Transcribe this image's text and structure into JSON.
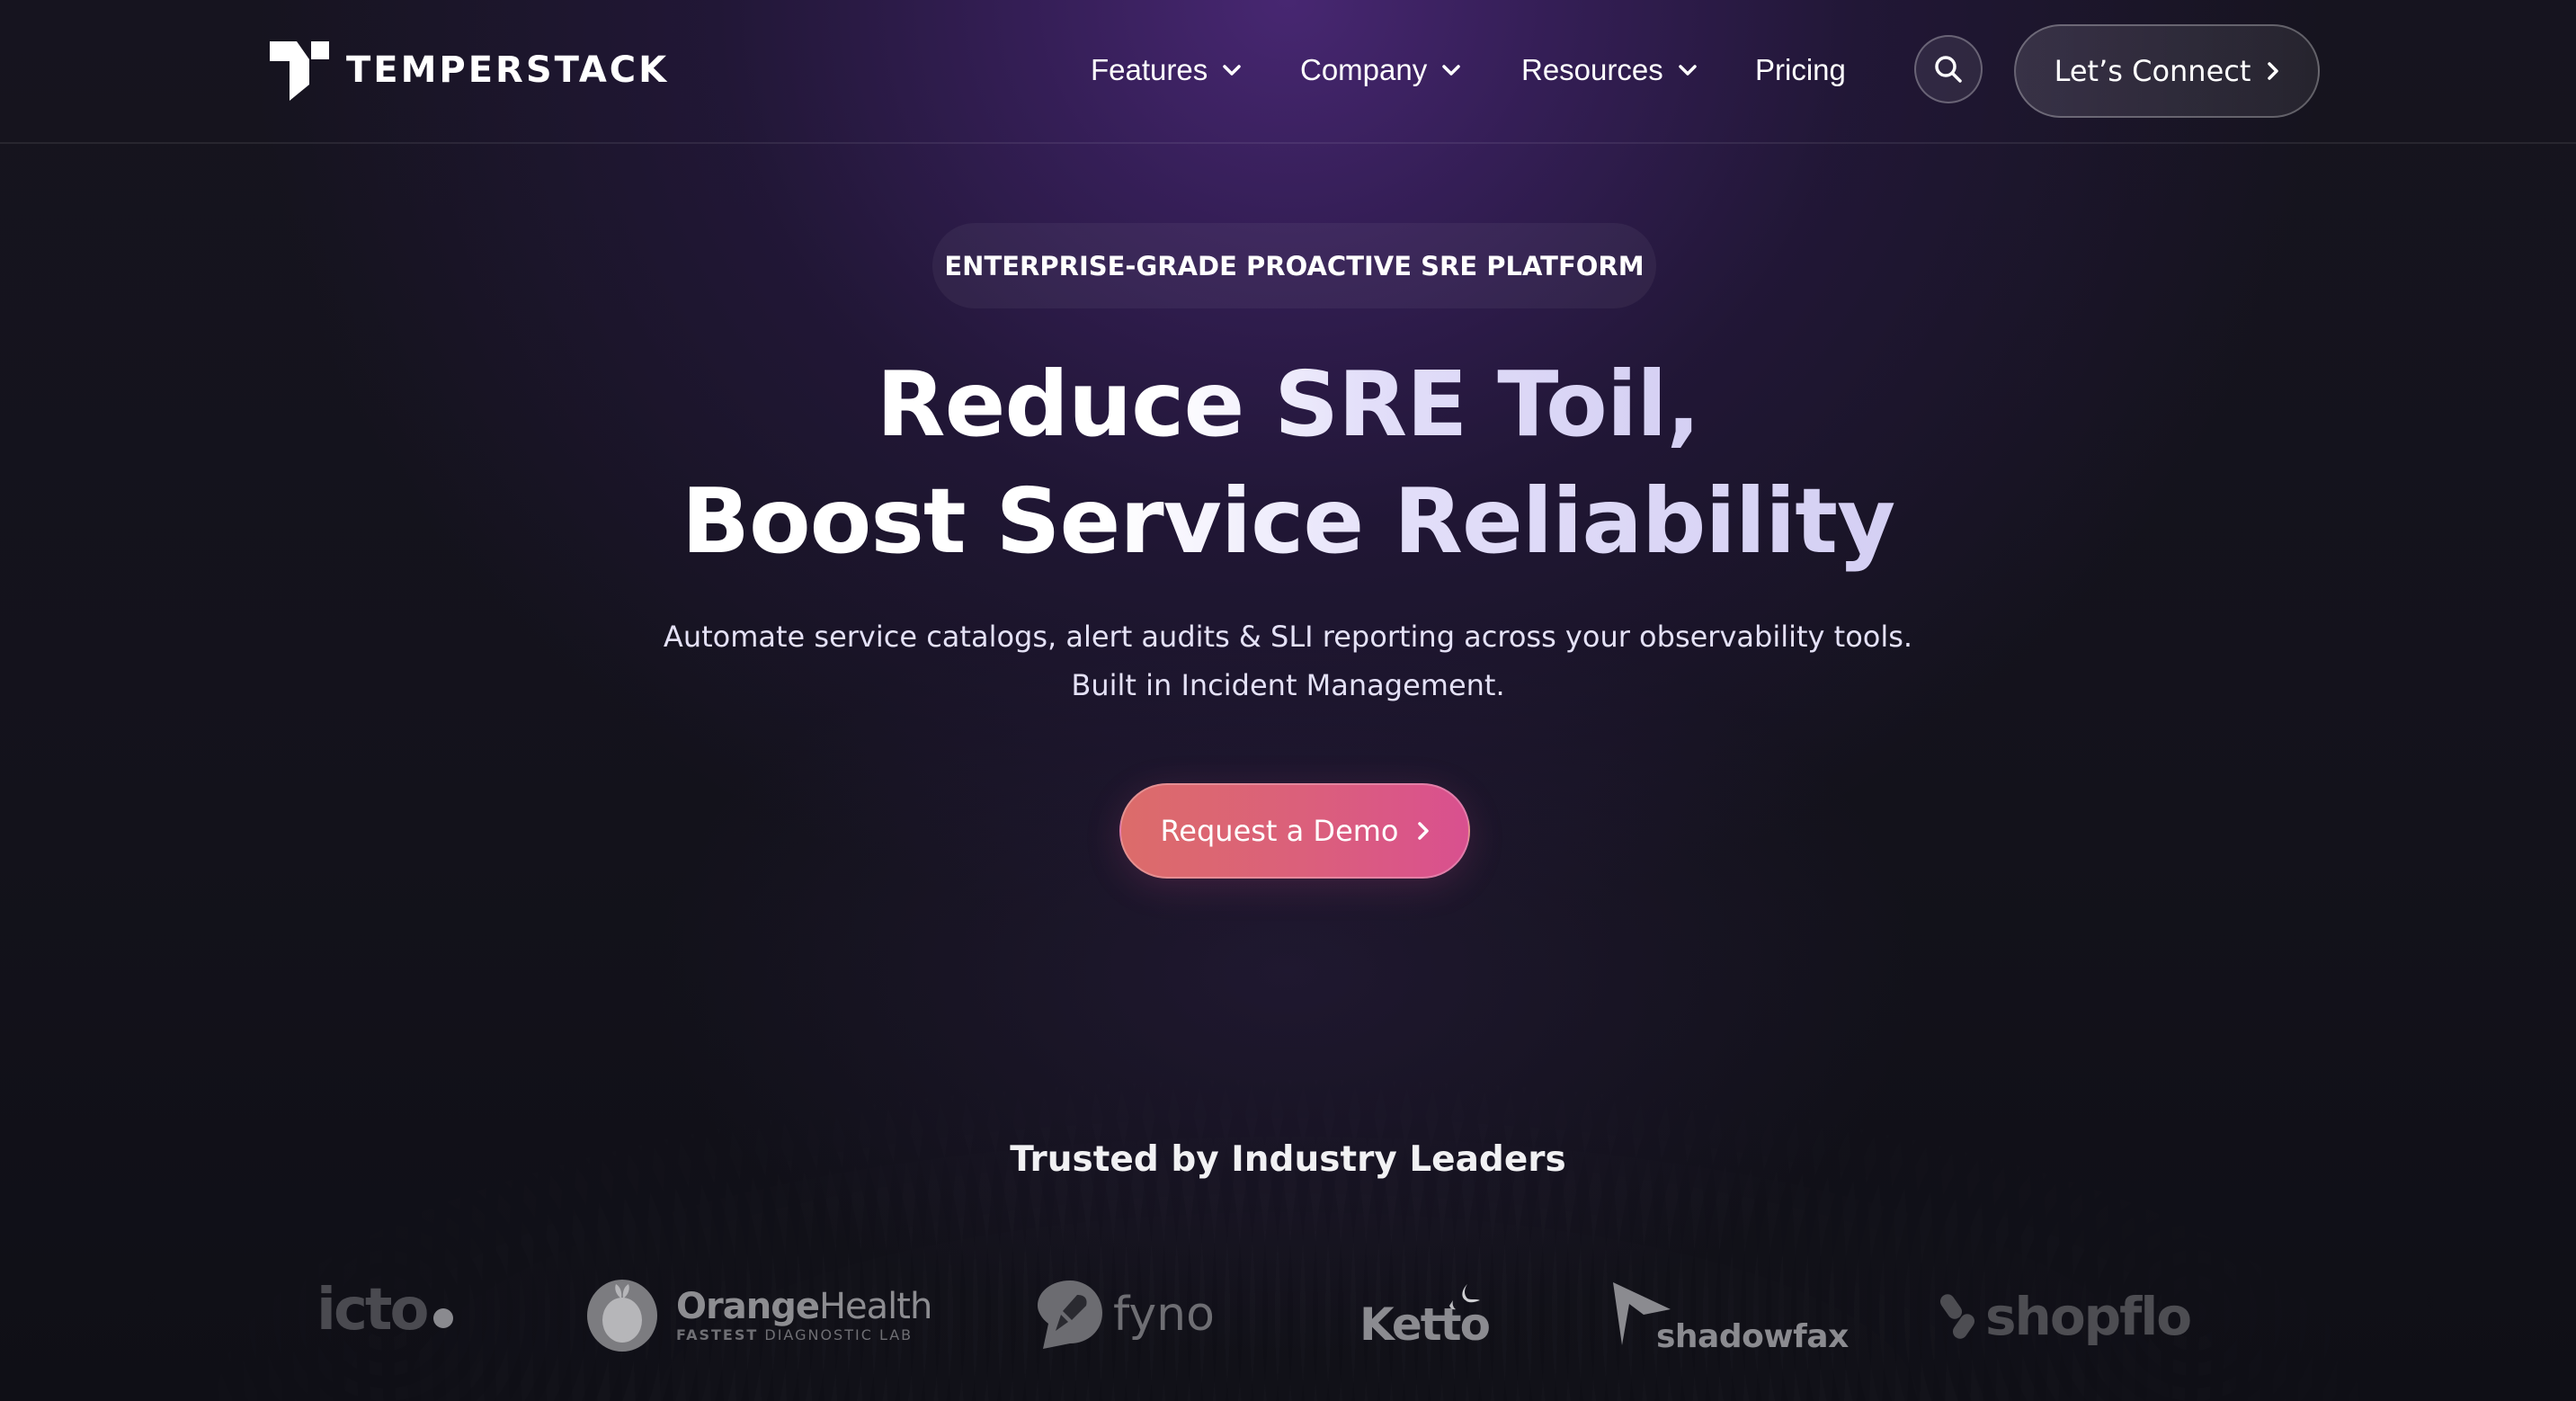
{
  "brand": {
    "name": "TEMPERSTACK",
    "logo_icon": "temperstack-t-mark-icon"
  },
  "nav": {
    "items": [
      {
        "label": "Features",
        "has_dropdown": true,
        "icon": "chevron-down-icon"
      },
      {
        "label": "Company",
        "has_dropdown": true,
        "icon": "chevron-down-icon"
      },
      {
        "label": "Resources",
        "has_dropdown": true,
        "icon": "chevron-down-icon"
      },
      {
        "label": "Pricing",
        "has_dropdown": false
      }
    ],
    "search_icon": "search-icon",
    "connect_label": "Let’s Connect",
    "connect_icon": "chevron-right-icon"
  },
  "hero": {
    "badge": "ENTERPRISE-GRADE PROACTIVE SRE PLATFORM",
    "headline_line1": "Reduce SRE Toil,",
    "headline_line2": "Boost Service Reliability",
    "subtitle_line1": "Automate service catalogs, alert audits & SLI reporting across your observability tools.",
    "subtitle_line2": "Built in Incident Management.",
    "cta_label": "Request a Demo",
    "cta_icon": "chevron-right-icon"
  },
  "trusted": {
    "title": "Trusted by Industry Leaders",
    "clients": [
      {
        "name": "icto",
        "display": "icto"
      },
      {
        "name": "OrangeHealth",
        "display_bold": "Orange",
        "display_regular": "Health",
        "tagline_bold": "FASTEST",
        "tagline_regular": "DIAGNOSTIC LAB"
      },
      {
        "name": "fyno",
        "display": "fyno"
      },
      {
        "name": "Ketto",
        "display": "Ketto"
      },
      {
        "name": "shadowfax",
        "display": "shadowfax"
      },
      {
        "name": "shopflo",
        "display": "shopflo"
      }
    ]
  },
  "colors": {
    "background_dark": "#12111a",
    "background_purple": "#3d2460",
    "cta_gradient_start": "#dc6c6a",
    "cta_gradient_end": "#d9508f",
    "headline_accent": "#d4cff3",
    "logo_gray": "#8d8d91"
  }
}
